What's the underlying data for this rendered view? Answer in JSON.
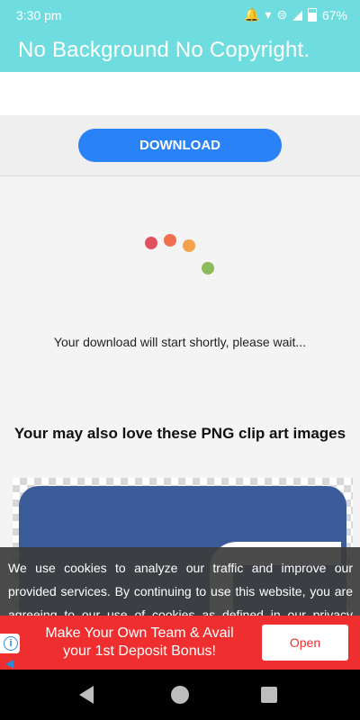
{
  "status_bar": {
    "time": "3:30 pm",
    "battery": "67%",
    "icons": [
      "notification-bell-icon",
      "wifi-icon",
      "hotspot-icon",
      "signal-icon",
      "battery-icon"
    ]
  },
  "app_bar": {
    "title": "No Background No Copyright."
  },
  "download": {
    "button_label": "DOWNLOAD"
  },
  "loader": {
    "dot_colors": [
      "#e0505e",
      "#f06f4e",
      "#f5a04c",
      "#8dbb5c"
    ],
    "message": "Your download will start shortly, please wait..."
  },
  "related": {
    "heading": "Your may also love these PNG clip art images",
    "image_icon": "facebook-logo-icon"
  },
  "cookie_notice": {
    "text": "We use cookies to analyze our traffic and improve our provided services. By continuing to use this website, you are agreeing to our use of cookies as defined in our privacy policy."
  },
  "ad": {
    "line1": "Make Your Own Team & Avail",
    "line2": "your 1st Deposit Bonus!",
    "open_label": "Open",
    "background": "#ef2f2f"
  },
  "nav_bar": {
    "icons": [
      "back-icon",
      "home-icon",
      "recents-icon"
    ]
  }
}
